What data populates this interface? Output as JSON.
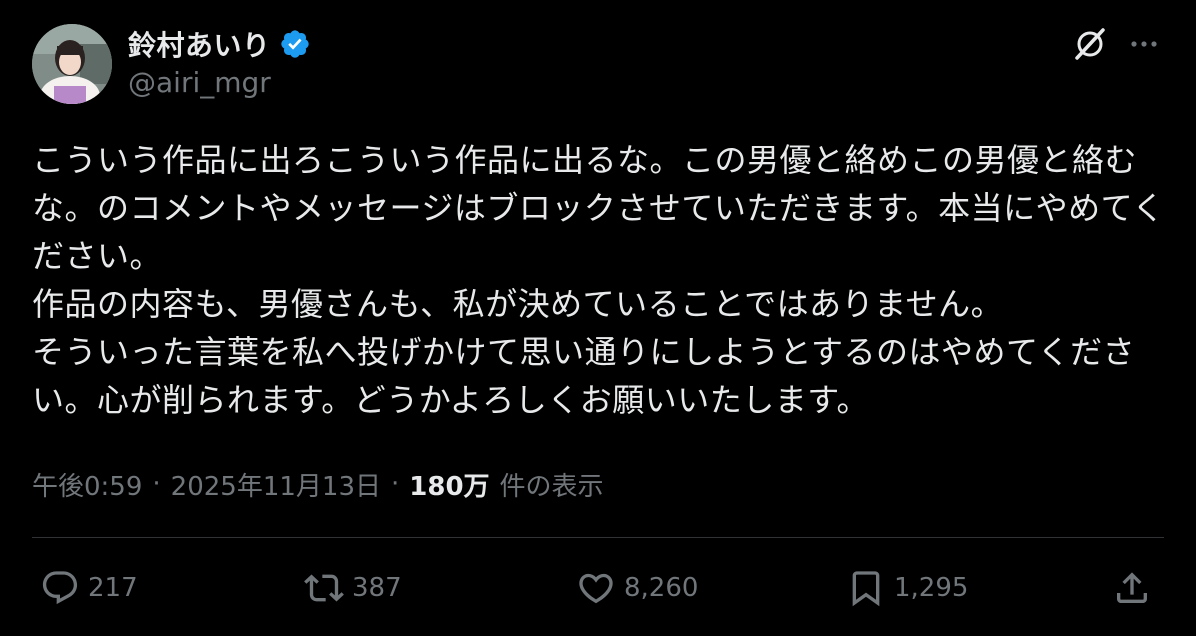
{
  "author": {
    "display_name": "鈴村あいり",
    "handle": "@airi_mgr",
    "verified": true
  },
  "tweet": {
    "text": "こういう作品に出ろこういう作品に出るな。この男優と絡めこの男優と絡むな。のコメントやメッセージはブロックさせていただきます。本当にやめてください。\n作品の内容も、男優さんも、私が決めていることではありません。\nそういった言葉を私へ投げかけて思い通りにしようとするのはやめてください。心が削られます。どうかよろしくお願いいたします。"
  },
  "meta": {
    "time": "午後0:59",
    "separator": "·",
    "date": "2025年11月13日",
    "views_count": "180万",
    "views_label": "件の表示"
  },
  "actions": {
    "reply_count": "217",
    "repost_count": "387",
    "like_count": "8,260",
    "bookmark_count": "1,295"
  },
  "colors": {
    "background": "#000000",
    "text_primary": "#e7e9ea",
    "text_secondary": "#71767b",
    "verified_blue": "#1d9bf0",
    "divider": "#2f3336"
  },
  "icons": {
    "grok": "grok-icon",
    "more": "more-dots-icon",
    "reply": "reply-bubble-icon",
    "repost": "repost-arrows-icon",
    "like": "heart-icon",
    "bookmark": "bookmark-icon",
    "share": "share-upload-icon",
    "verified": "verified-badge-icon"
  }
}
